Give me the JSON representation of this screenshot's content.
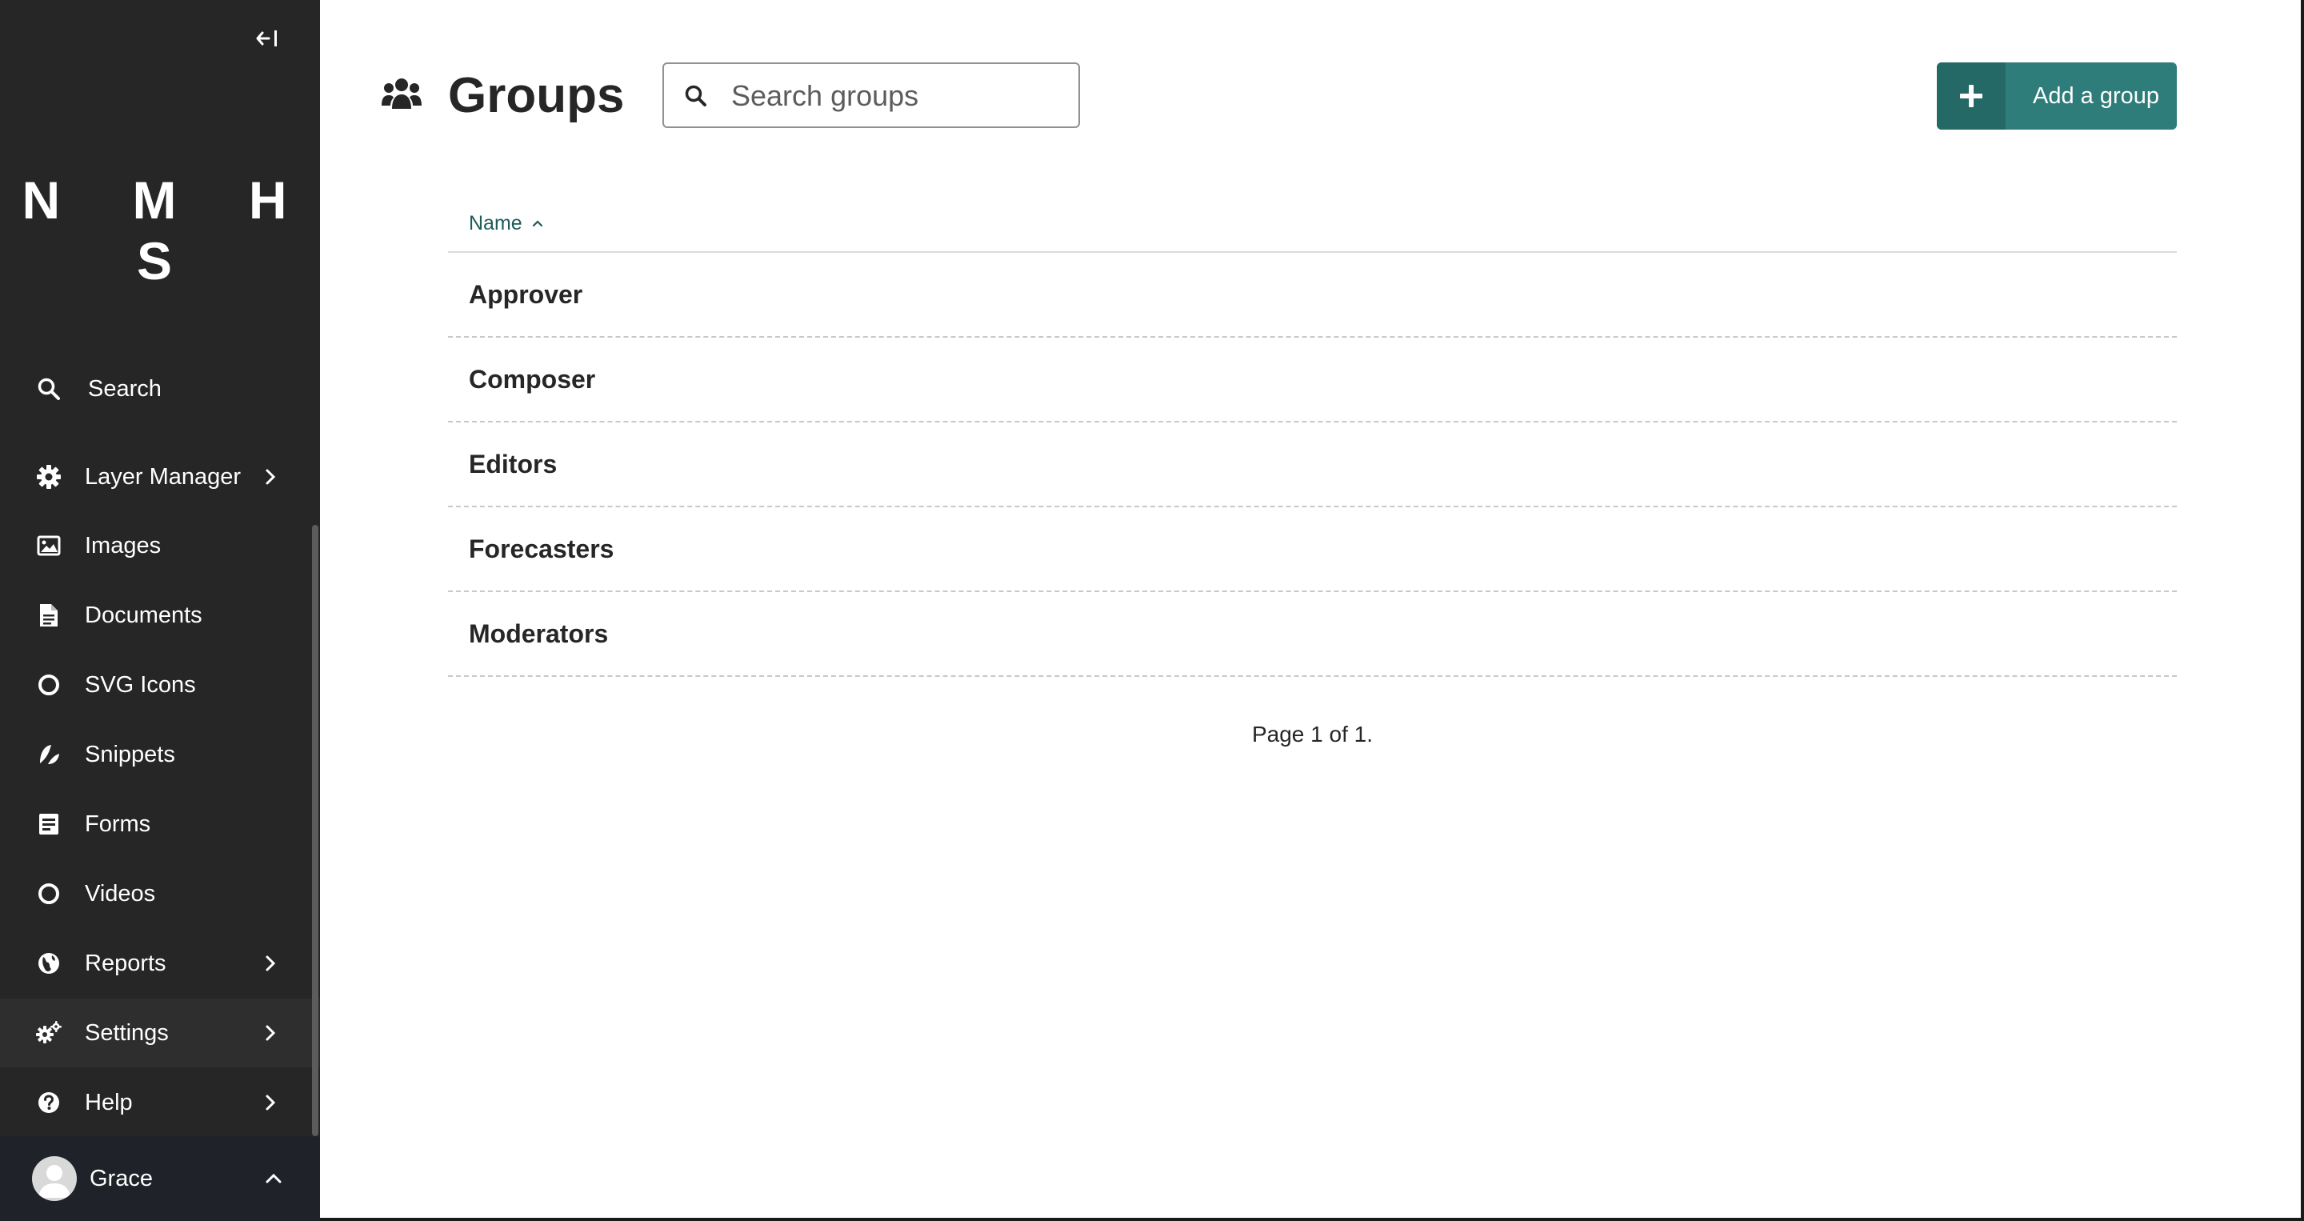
{
  "sidebar": {
    "collapse_icon": "collapse-left-icon",
    "logo": "N M H S",
    "search_label": "Search",
    "items": [
      {
        "label": "Layer Manager",
        "icon": "cog-icon",
        "has_submenu": true
      },
      {
        "label": "Images",
        "icon": "image-icon",
        "has_submenu": false
      },
      {
        "label": "Documents",
        "icon": "document-icon",
        "has_submenu": false
      },
      {
        "label": "SVG Icons",
        "icon": "circle-icon",
        "has_submenu": false
      },
      {
        "label": "Snippets",
        "icon": "snippet-icon",
        "has_submenu": false
      },
      {
        "label": "Forms",
        "icon": "form-icon",
        "has_submenu": false
      },
      {
        "label": "Videos",
        "icon": "circle-icon",
        "has_submenu": false
      },
      {
        "label": "Reports",
        "icon": "globe-icon",
        "has_submenu": true
      },
      {
        "label": "Settings",
        "icon": "cogs-icon",
        "has_submenu": true,
        "active": true
      },
      {
        "label": "Help",
        "icon": "help-icon",
        "has_submenu": true
      }
    ],
    "account": {
      "name": "Grace"
    }
  },
  "header": {
    "title": "Groups",
    "title_icon": "group-icon",
    "search_placeholder": "Search groups",
    "search_value": "",
    "add_button_label": "Add a group"
  },
  "table": {
    "column_name": "Name",
    "sort": "ascending",
    "rows": [
      "Approver",
      "Composer",
      "Editors",
      "Forecasters",
      "Moderators"
    ]
  },
  "pagination": "Page 1 of 1.",
  "colors": {
    "sidebar_bg": "#262626",
    "accent": "#2e7d7a",
    "accent_dark": "#246966",
    "link": "#1d5b5a"
  }
}
